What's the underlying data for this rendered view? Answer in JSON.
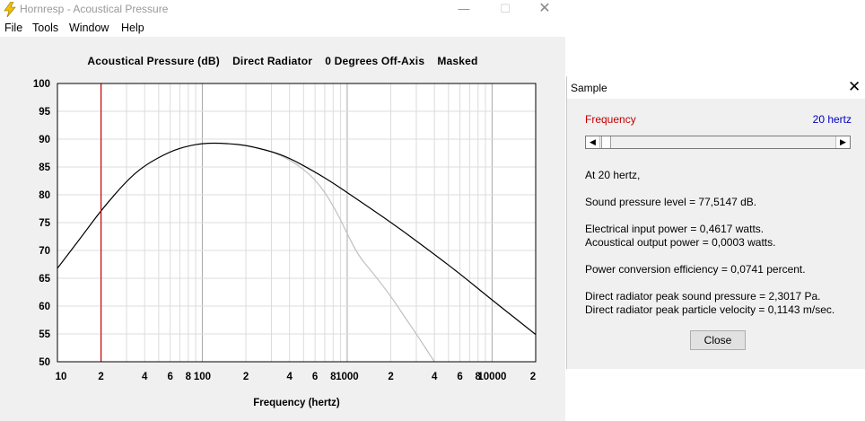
{
  "window": {
    "title": "Hornresp - Acoustical Pressure",
    "minimize": "—",
    "maximize": "☐",
    "close": "✕"
  },
  "menu": [
    "File",
    "Tools",
    "Window",
    "Help"
  ],
  "chart_data": {
    "type": "line",
    "title": "Acoustical Pressure (dB)    Direct Radiator    0 Degrees Off-Axis    Masked",
    "xlabel": "Frequency (hertz)",
    "ylabel": "",
    "x_scale": "log",
    "xlim": [
      10,
      20000
    ],
    "ylim": [
      50,
      100
    ],
    "ytick_labels": [
      "100",
      "95",
      "90",
      "85",
      "80",
      "75",
      "70",
      "65",
      "60",
      "55",
      "50"
    ],
    "ytick_values": [
      100,
      95,
      90,
      85,
      80,
      75,
      70,
      65,
      60,
      55,
      50
    ],
    "xtick_labels": [
      "10",
      "2",
      "4",
      "6",
      "8",
      "100",
      "2",
      "4",
      "6",
      "8",
      "1000",
      "2",
      "4",
      "6",
      "8",
      "10000",
      "2"
    ],
    "xtick_values": [
      10,
      20,
      40,
      60,
      80,
      100,
      200,
      400,
      600,
      800,
      1000,
      2000,
      4000,
      6000,
      8000,
      10000,
      20000
    ],
    "marker_frequency": 20,
    "series": [
      {
        "color": "#000000",
        "x": [
          10,
          12,
          15,
          20,
          30,
          40,
          60,
          80,
          100,
          120,
          150,
          200,
          300,
          400,
          600,
          800,
          1000,
          2000,
          4000,
          6000,
          10000,
          20000
        ],
        "y": [
          66.8,
          69.5,
          72.8,
          77.2,
          82.5,
          85.3,
          87.8,
          88.8,
          89.2,
          89.3,
          89.2,
          88.9,
          87.8,
          86.6,
          84.1,
          82.1,
          80.4,
          75.1,
          69.3,
          65.8,
          61.1,
          54.9
        ]
      },
      {
        "color": "#c0c0c0",
        "x": [
          300,
          400,
          500,
          600,
          700,
          800,
          900,
          1000,
          1200,
          1500,
          2000,
          2500,
          3000,
          4000
        ],
        "y": [
          87.8,
          86.3,
          84.6,
          82.7,
          80.5,
          78.0,
          75.5,
          73.0,
          69.0,
          66.0,
          61.8,
          58.0,
          55.0,
          50.0
        ]
      }
    ]
  },
  "dialog": {
    "title": "Sample",
    "close_icon": "✕",
    "frequency_label": "Frequency",
    "frequency_value": "20 hertz",
    "scroll_left": "◀",
    "scroll_right": "▶",
    "line1": "At 20 hertz,",
    "line2": "Sound pressure level = 77,5147 dB.",
    "line3": "Electrical input power = 0,4617 watts.",
    "line4": "Acoustical output power = 0,0003 watts.",
    "line5": "Power conversion efficiency = 0,0741 percent.",
    "line6": "Direct radiator peak sound pressure = 2,3017 Pa.",
    "line7": "Direct radiator peak particle velocity = 0,1143 m/sec.",
    "close_button": "Close"
  }
}
